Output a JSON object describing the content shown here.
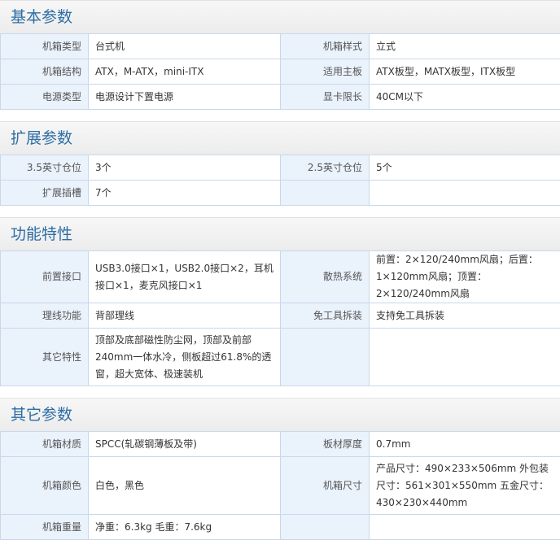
{
  "sections": [
    {
      "title": "基本参数",
      "rows": [
        [
          "机箱类型",
          "台式机",
          "机箱样式",
          "立式"
        ],
        [
          "机箱结构",
          "ATX，M-ATX，mini-ITX",
          "适用主板",
          "ATX板型，MATX板型，ITX板型"
        ],
        [
          "电源类型",
          "电源设计下置电源",
          "显卡限长",
          "40CM以下"
        ]
      ]
    },
    {
      "title": "扩展参数",
      "rows": [
        [
          "3.5英寸仓位",
          "3个",
          "2.5英寸仓位",
          "5个"
        ],
        [
          "扩展插槽",
          "7个",
          "",
          ""
        ]
      ]
    },
    {
      "title": "功能特性",
      "rows": [
        [
          "前置接口",
          "USB3.0接口×1，USB2.0接口×2，耳机接口×1，麦克风接口×1",
          "散热系统",
          "前置：2×120/240mm风扇；后置：1×120mm风扇；顶置：2×120/240mm风扇"
        ],
        [
          "理线功能",
          "背部理线",
          "免工具拆装",
          "支持免工具拆装"
        ],
        [
          "其它特性",
          "顶部及底部磁性防尘网，顶部及前部240mm一体水冷，侧板超过61.8%的透窗，超大宽体、极速装机",
          "",
          ""
        ]
      ]
    },
    {
      "title": "其它参数",
      "rows": [
        [
          "机箱材质",
          "SPCC(轧碳钢薄板及带)",
          "板材厚度",
          "0.7mm"
        ],
        [
          "机箱颜色",
          "白色，黑色",
          "机箱尺寸",
          "产品尺寸：490×233×506mm 外包装尺寸：561×301×550mm 五金尺寸：430×230×440mm"
        ],
        [
          "机箱重量",
          "净重：6.3kg 毛重：7.6kg",
          "",
          ""
        ]
      ]
    }
  ]
}
